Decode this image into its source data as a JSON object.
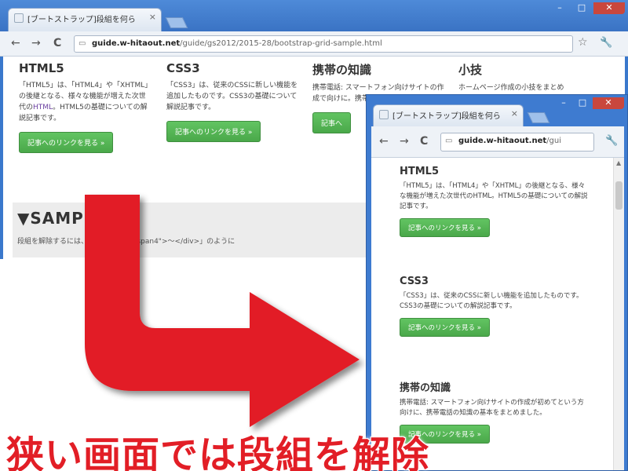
{
  "wide_window": {
    "tab_title": "[ブートストラップ]段組を何ら",
    "tab_close": "×",
    "controls": {
      "minimize": "–",
      "maximize": "□",
      "close": "✕"
    },
    "toolbar": {
      "back": "←",
      "forward": "→",
      "reload": "C",
      "star": "☆",
      "wrench": "🔧"
    },
    "url": {
      "host": "guide.w-hitaout.net",
      "path": "/guide/gs2012/2015-28/bootstrap-grid-sample.html"
    },
    "columns": [
      {
        "heading": "HTML5",
        "text_parts": [
          "「HTML5」は、「HTML4」や「XHTML」の後継となる、様々な機能が増えた次世代の",
          "HTML",
          "。HTML5の基礎について",
          "の解説記事です。"
        ],
        "button": "記事へのリンクを見る »"
      },
      {
        "heading": "CSS3",
        "text_parts": [
          "「CSS3」は、従来のCSSに新しい機能を追加したものです。CSS3の基礎について",
          "",
          "",
          "解説記事です。"
        ],
        "button": "記事へのリンクを見る »"
      },
      {
        "heading": "携帯の知識",
        "text_parts": [
          "携帯電話: スマートフォン向けサイトの作成で",
          "",
          "",
          "向けに。携帯電話の知識を解説"
        ],
        "button": "記事へ"
      },
      {
        "heading": "小技",
        "text_parts": [
          "ホームページ作成の小技をまとめ",
          "",
          "",
          ""
        ],
        "button": ""
      }
    ],
    "sample_title": "▼SAMPLE",
    "sample_desc": "段組を解除するには、「<div class=\"span4\">〜</div>」のように"
  },
  "narrow_window": {
    "tab_title": "[ブートストラップ]段組を何ら",
    "tab_close": "×",
    "controls": {
      "minimize": "–",
      "maximize": "□",
      "close": "✕"
    },
    "toolbar": {
      "back": "←",
      "forward": "→",
      "reload": "C",
      "wrench": "🔧"
    },
    "url": {
      "host": "guide.w-hitaout.net",
      "path": "/gui"
    },
    "columns": [
      {
        "heading": "HTML5",
        "text": "「HTML5」は、「HTML4」や「XHTML」の後継となる、様々な機能が増えた次世代のHTML。HTML5の基礎についての解説記事です。",
        "button": "記事へのリンクを見る »"
      },
      {
        "heading": "CSS3",
        "text": "「CSS3」は、従来のCSSに新しい機能を追加したものです。CSS3の基礎についての解説記事です。",
        "button": "記事へのリンクを見る »"
      },
      {
        "heading": "携帯の知識",
        "text": "携帯電話: スマートフォン向けサイトの作成が初めてという方向けに、携帯電話の知識の基本をまとめました。",
        "button": "記事へのリンクを見る »"
      }
    ]
  },
  "colors": {
    "arrow": "#e21e26",
    "caption": "#e21e26",
    "button": "#4aa84a",
    "titlebar": "#3a78cc"
  },
  "caption": "狭い画面では段組を解除"
}
